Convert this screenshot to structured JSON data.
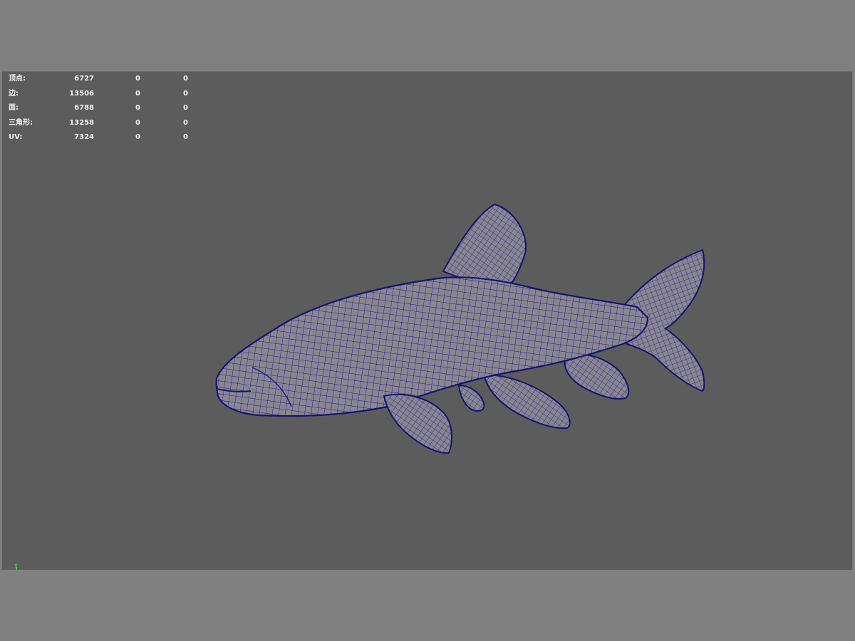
{
  "stats": [
    {
      "label": "顶点:",
      "v1": "6727",
      "v2": "0",
      "v3": "0"
    },
    {
      "label": "边:",
      "v1": "13506",
      "v2": "0",
      "v3": "0"
    },
    {
      "label": "面:",
      "v1": "6788",
      "v2": "0",
      "v3": "0"
    },
    {
      "label": "三角形:",
      "v1": "13258",
      "v2": "0",
      "v3": "0"
    },
    {
      "label": "UV:",
      "v1": "7324",
      "v2": "0",
      "v3": "0"
    }
  ],
  "axis_label": "y",
  "colors": {
    "viewport_bg": "#5c5c5c",
    "mesh_fill": "#8a8690",
    "wire": "#1a1a8c",
    "hud_text": "#f2f2f2",
    "axis": "#3cff3c"
  }
}
